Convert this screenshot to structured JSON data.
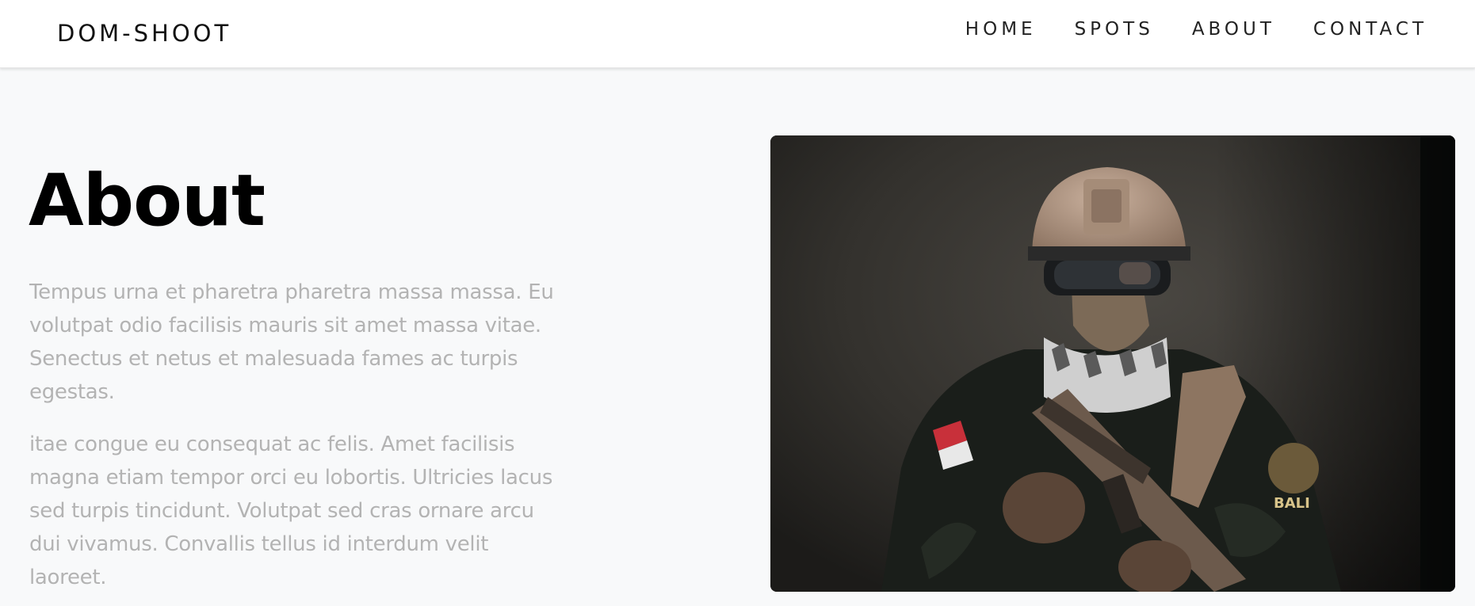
{
  "navbar": {
    "brand": "DOM-SHOOT",
    "links": [
      {
        "label": "HOME"
      },
      {
        "label": "SPOTS"
      },
      {
        "label": "ABOUT"
      },
      {
        "label": "CONTACT"
      }
    ]
  },
  "about": {
    "title": "About",
    "paragraphs": [
      "Tempus urna et pharetra pharetra massa massa. Eu volutpat odio facilisis mauris sit amet massa vitae. Senectus et netus et malesuada fames ac turpis egestas.",
      "itae congue eu consequat ac felis. Amet facilisis magna etiam tempor orci eu lobortis. Ultricies lacus sed turpis tincidunt. Volutpat sed cras ornare arcu dui vivamus. Convallis tellus id interdum velit laoreet."
    ]
  },
  "photo": {
    "subject": "airsoft-player-portrait",
    "patch_text": "BALI"
  },
  "colors": {
    "background": "#f8f9fa",
    "navbar": "#ffffff",
    "title": "#000000",
    "body_text": "#b3b3b3"
  }
}
